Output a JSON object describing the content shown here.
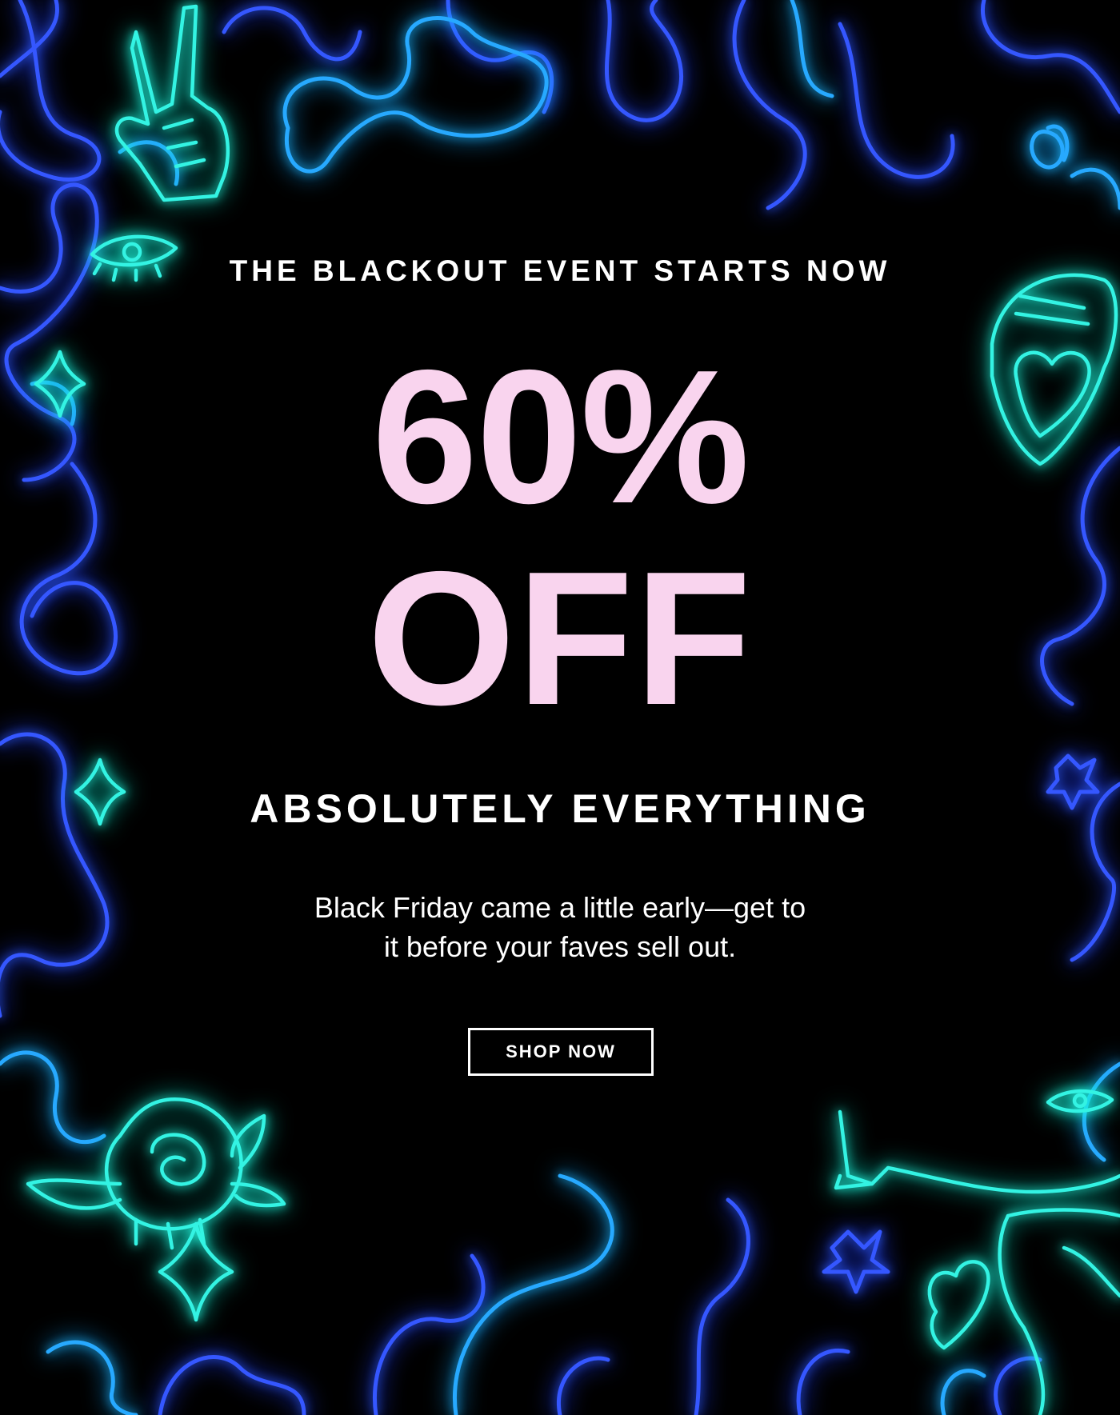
{
  "promo": {
    "kicker": "THE BLACKOUT EVENT STARTS NOW",
    "headline_line1": "60%",
    "headline_line2": "OFF",
    "subhead": "ABSOLUTELY EVERYTHING",
    "body_line1": "Black Friday came a little early—get to",
    "body_line2": "it before your faves sell out.",
    "cta_label": "SHOP NOW"
  },
  "colors": {
    "background": "#000000",
    "headline": "#f9d4ee",
    "text": "#ffffff",
    "neon_blue": "#2f5bff",
    "neon_sky": "#1fb7ff",
    "neon_teal": "#2bffe6"
  },
  "decorations": [
    "peace-hand-icon",
    "eye-icon",
    "lips-tongue-heart-icon",
    "sparkle-icon",
    "star-icon",
    "heart-icon",
    "rose-icon",
    "legs-heels-icon"
  ]
}
